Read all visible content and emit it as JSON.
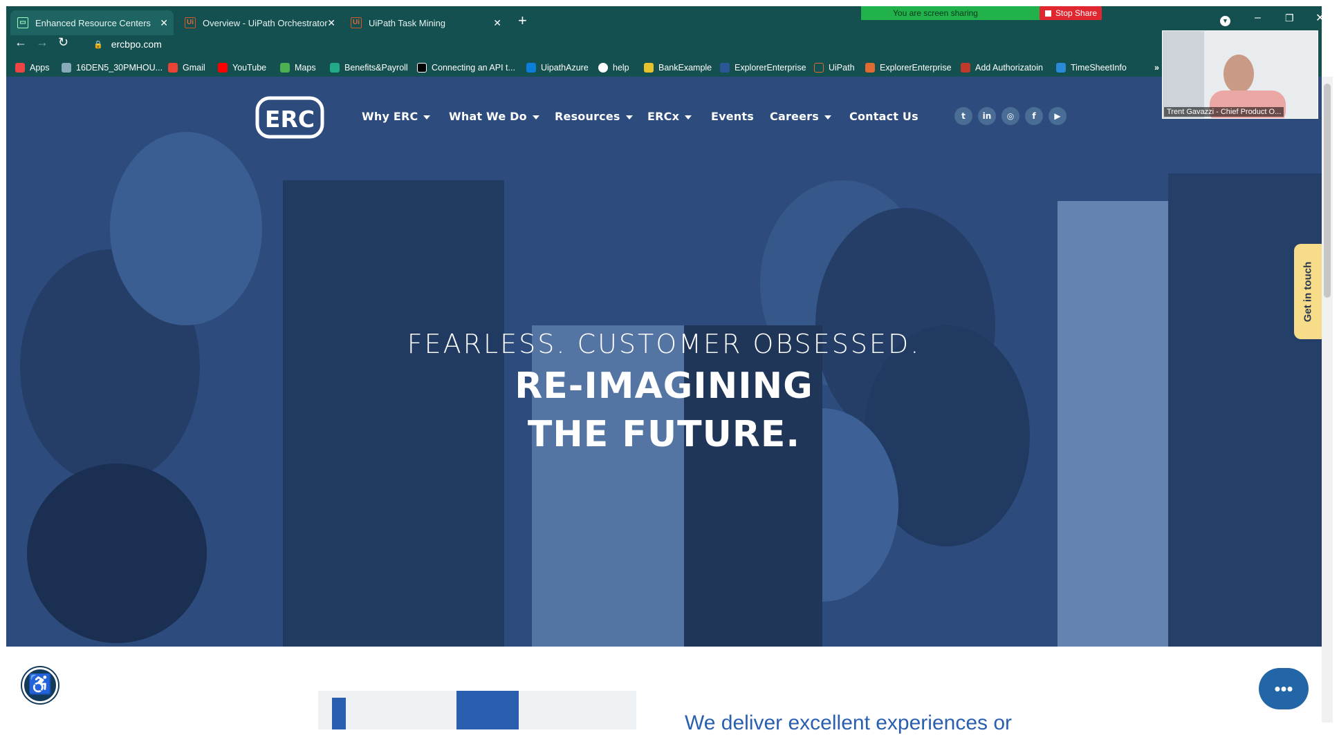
{
  "browser": {
    "tabs": [
      {
        "title": "Enhanced Resource Centers - ER"
      },
      {
        "title": "Overview - UiPath Orchestrator"
      },
      {
        "title": "UiPath Task Mining"
      }
    ],
    "url": "ercbpo.com",
    "bookmarks": [
      "Apps",
      "16DEN5_30PMHOU...",
      "Gmail",
      "YouTube",
      "Maps",
      "Benefits&Payroll",
      "Connecting an API t...",
      "UipathAzure",
      "help",
      "BankExample",
      "ExplorerEnterprise",
      "UiPath",
      "ExplorerEnterprise",
      "Add Authorizatoin",
      "TimeSheetInfo"
    ],
    "overflow": "»"
  },
  "sharing": {
    "status": "You are screen sharing",
    "stop_label": "Stop Share"
  },
  "video": {
    "caption": "Trent Gavazzi - Chief Product O..."
  },
  "site": {
    "logo": "ERC",
    "nav": [
      {
        "label": "Why ERC",
        "dropdown": true
      },
      {
        "label": "What We Do",
        "dropdown": true
      },
      {
        "label": "Resources",
        "dropdown": true
      },
      {
        "label": "ERCx",
        "dropdown": true
      },
      {
        "label": "Events",
        "dropdown": false
      },
      {
        "label": "Careers",
        "dropdown": true
      },
      {
        "label": "Contact Us",
        "dropdown": false
      }
    ],
    "social": [
      "twitter-icon",
      "linkedin-icon",
      "instagram-icon",
      "facebook-icon",
      "youtube-icon"
    ],
    "hero": {
      "tagline": "FEARLESS. CUSTOMER OBSESSED.",
      "headline_1": "RE-IMAGINING",
      "headline_2": "THE FUTURE."
    },
    "get_in_touch": "Get in touch",
    "below_fold_text": "We deliver excellent experiences or"
  },
  "colors": {
    "chrome": "#13504f",
    "hero_overlay": "#2e4e80",
    "share_green": "#22b24c",
    "stop_red": "#e0262f"
  }
}
